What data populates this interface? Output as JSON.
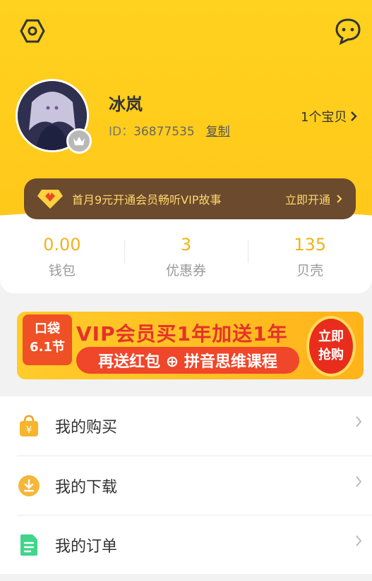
{
  "profile": {
    "username": "冰岚",
    "id_label": "ID：",
    "id_value": "36877535",
    "copy_label": "复制",
    "baby_link": "1个宝贝"
  },
  "vip_banner": {
    "text": "首月9元开通会员畅听VIP故事",
    "cta": "立即开通"
  },
  "stats": [
    {
      "value": "0.00",
      "label": "钱包"
    },
    {
      "value": "3",
      "label": "优惠券"
    },
    {
      "value": "135",
      "label": "贝壳"
    }
  ],
  "promo": {
    "tag_line1": "口袋",
    "tag_line2": "6.1节",
    "title": "VIP会员买1年加送1年",
    "subtitle": "再送红包 ⊕ 拼音思维课程",
    "button_line1": "立即",
    "button_line2": "抢购"
  },
  "menu": [
    {
      "label": "我的购买",
      "icon": "shopping-bag-icon"
    },
    {
      "label": "我的下载",
      "icon": "download-icon"
    },
    {
      "label": "我的订单",
      "icon": "document-icon"
    }
  ],
  "colors": {
    "brand_yellow": "#ffc81a",
    "accent_orange": "#f2b31b",
    "vip_brown": "#6b4a2e"
  }
}
